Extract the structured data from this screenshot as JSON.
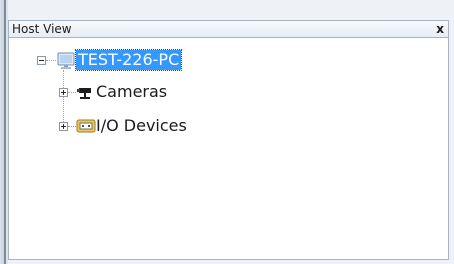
{
  "panel": {
    "title": "Host View",
    "close_label": "x"
  },
  "tree": {
    "root": {
      "label": "TEST-226-PC",
      "icon": "computer-icon",
      "expanded": true,
      "selected": true
    },
    "children": [
      {
        "label": "Cameras",
        "icon": "camera-icon",
        "expanded": false
      },
      {
        "label": "I/O Devices",
        "icon": "io-device-icon",
        "expanded": false
      }
    ]
  },
  "colors": {
    "selection": "#3399ff",
    "panel_border": "#a7b4c3"
  }
}
